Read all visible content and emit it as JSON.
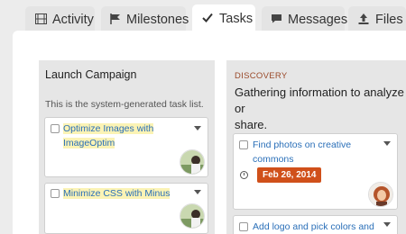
{
  "tabs": [
    {
      "label": "Activity",
      "icon": "film-icon"
    },
    {
      "label": "Milestones",
      "icon": "flag-icon"
    },
    {
      "label": "Tasks",
      "icon": "check-icon",
      "active": true
    },
    {
      "label": "Messages",
      "icon": "message-icon"
    },
    {
      "label": "Files",
      "icon": "upload-icon"
    }
  ],
  "left_column": {
    "title": "Launch Campaign",
    "description": "This is the system-generated task list.",
    "tasks": [
      {
        "label_line1": "Optimize Images with",
        "label_line2": "ImageOptim"
      },
      {
        "label_line1": "Minimize CSS with Minus"
      }
    ]
  },
  "right_column": {
    "kicker": "DISCOVERY",
    "title_line1": "Gathering information to analyze or",
    "title_line2": "share.",
    "tasks": [
      {
        "label_line1": "Find photos on creative",
        "label_line2": "commons",
        "due_date": "Feb 26, 2014"
      },
      {
        "label_line1": "Add logo and pick colors and"
      }
    ]
  },
  "colors": {
    "accent": "#d0501a",
    "link": "#2a6fb8",
    "highlight": "#fbf3b5"
  }
}
